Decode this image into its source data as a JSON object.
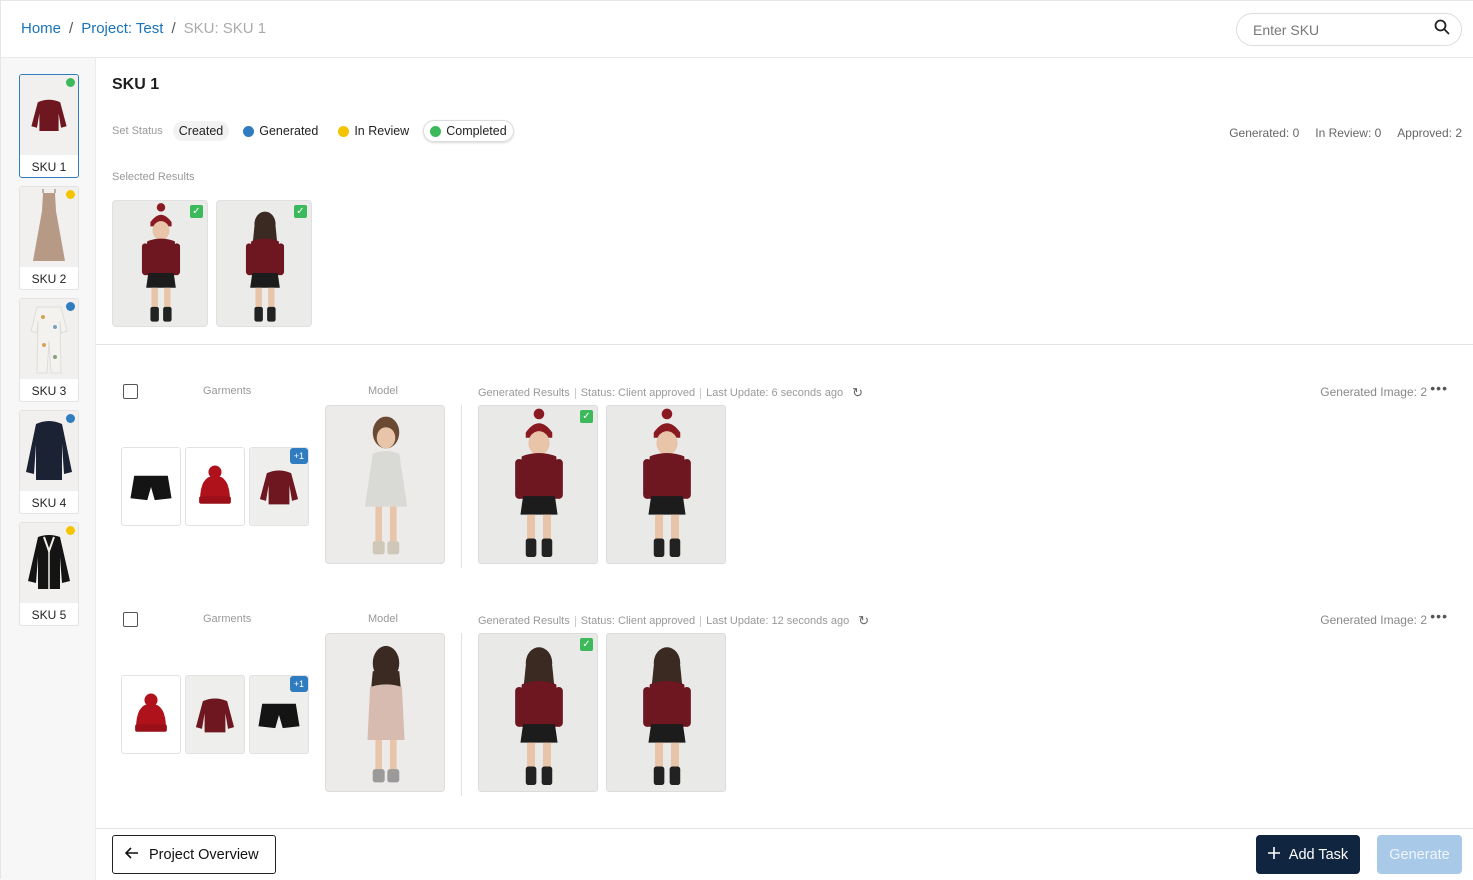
{
  "breadcrumb": {
    "home": "Home",
    "project": "Project: Test",
    "current": "SKU: SKU 1"
  },
  "search": {
    "placeholder": "Enter SKU"
  },
  "sidebar": {
    "items": [
      {
        "label": "SKU 1",
        "status_color": "#3cb95a"
      },
      {
        "label": "SKU 2",
        "status_color": "#f5c400"
      },
      {
        "label": "SKU 3",
        "status_color": "#2f7cc0"
      },
      {
        "label": "SKU 4",
        "status_color": "#2f7cc0"
      },
      {
        "label": "SKU 5",
        "status_color": "#f5c400"
      }
    ]
  },
  "main": {
    "title": "SKU 1",
    "set_status_label": "Set Status",
    "statuses": {
      "created": "Created",
      "generated": "Generated",
      "in_review": "In Review",
      "completed": "Completed"
    },
    "status_colors": {
      "generated": "#2f7cc0",
      "in_review": "#f5c400",
      "completed": "#3cb95a"
    },
    "stats": {
      "generated": "Generated: 0",
      "in_review": "In Review: 0",
      "approved": "Approved: 2"
    },
    "selected_results_label": "Selected Results"
  },
  "tasks": [
    {
      "garments_label": "Garments",
      "model_label": "Model",
      "results_label": "Generated Results",
      "status": "Status: Client approved",
      "last_update": "Last Update: 6 seconds ago",
      "generated_count": "Generated Image: 2",
      "extra_badge": "+1"
    },
    {
      "garments_label": "Garments",
      "model_label": "Model",
      "results_label": "Generated Results",
      "status": "Status: Client approved",
      "last_update": "Last Update: 12 seconds ago",
      "generated_count": "Generated Image: 2",
      "extra_badge": "+1"
    }
  ],
  "footer": {
    "overview": "Project Overview",
    "add_task": "Add Task",
    "generate": "Generate"
  },
  "colors": {
    "accent": "#2f7cc0",
    "success": "#3cb95a",
    "primary_dark": "#10253f",
    "disabled": "#a8c9e8"
  }
}
